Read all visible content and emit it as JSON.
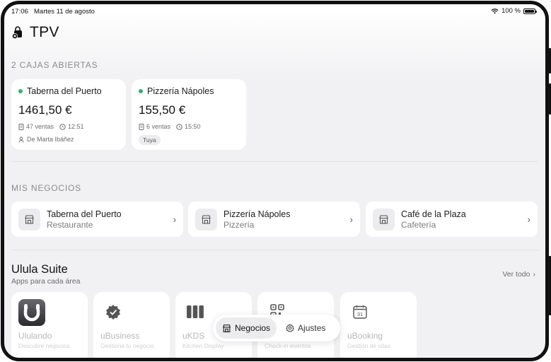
{
  "status_bar": {
    "time": "17:06",
    "date": "Martes 11 de agosto",
    "battery": "100 %"
  },
  "header": {
    "title": "TPV",
    "icon": "bag-plus-icon"
  },
  "open_registers": {
    "label": "2 CAJAS ABIERTAS",
    "items": [
      {
        "name": "Taberna del Puerto",
        "amount": "1461,50 €",
        "sales": "47 ventas",
        "time": "12:51",
        "opened_by": "De Marta Ibáñez",
        "status_color": "#2bb673"
      },
      {
        "name": "Pizzería Nápoles",
        "amount": "155,50 €",
        "sales": "6 ventas",
        "time": "15:50",
        "tag": "Tuya",
        "status_color": "#2bb673"
      }
    ]
  },
  "businesses": {
    "label": "MIS NEGOCIOS",
    "items": [
      {
        "name": "Taberna del Puerto",
        "type": "Restaurante"
      },
      {
        "name": "Pizzería Nápoles",
        "type": "Pizzería"
      },
      {
        "name": "Café de la Plaza",
        "type": "Cafetería"
      }
    ]
  },
  "suite": {
    "title": "Ulula Suite",
    "subtitle": "Apps para cada área",
    "see_all": "Ver todo",
    "apps": [
      {
        "name": "Ululando",
        "desc": "Descubre negocios",
        "icon": "ululando-logo-icon"
      },
      {
        "name": "uBusiness",
        "desc": "Gestiona tu negocio",
        "icon": "verified-badge-icon"
      },
      {
        "name": "uKDS",
        "desc": "Kitchen Display",
        "icon": "columns-icon"
      },
      {
        "name": "",
        "desc": "Check-in eventos",
        "icon": "qr-code-icon"
      },
      {
        "name": "uBooking",
        "desc": "Gestión de citas",
        "icon": "calendar-icon"
      }
    ]
  },
  "tabbar": {
    "tabs": [
      {
        "label": "Negocios",
        "icon": "store-icon",
        "active": true
      },
      {
        "label": "Ajustes",
        "icon": "gear-icon",
        "active": false
      }
    ]
  }
}
